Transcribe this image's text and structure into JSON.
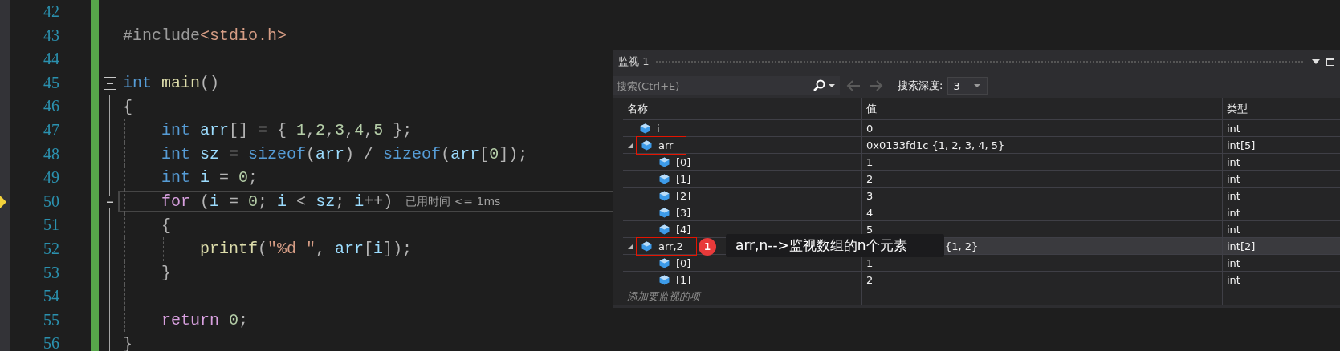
{
  "editor": {
    "lines": [
      {
        "number": "42",
        "fold": false,
        "current": false
      },
      {
        "number": "43",
        "fold": false,
        "current": false,
        "tokens": [
          {
            "t": "#include",
            "color": "#9b9b9b"
          },
          {
            "t": "<stdio.h>",
            "color": "#d69d85"
          }
        ]
      },
      {
        "number": "44",
        "fold": false,
        "current": false
      },
      {
        "number": "45",
        "fold": true,
        "current": false,
        "tokens": [
          {
            "t": "int ",
            "color": "#569cd6"
          },
          {
            "t": "main",
            "color": "#dcdcaa"
          },
          {
            "t": "()",
            "color": "#b4b4b4"
          }
        ]
      },
      {
        "number": "46",
        "fold": false,
        "current": false,
        "tokens": [
          {
            "t": "{",
            "color": "#b4b4b4"
          }
        ],
        "children": [
          {
            "number": "47",
            "fold": false,
            "current": false,
            "tokens": [
              {
                "t": "int ",
                "color": "#569cd6"
              },
              {
                "t": "arr",
                "color": "#9cdcfe"
              },
              {
                "t": "[] = { ",
                "color": "#b4b4b4"
              },
              {
                "t": "1",
                "color": "#b5cea8"
              },
              {
                "t": ",",
                "color": "#b4b4b4"
              },
              {
                "t": "2",
                "color": "#b5cea8"
              },
              {
                "t": ",",
                "color": "#b4b4b4"
              },
              {
                "t": "3",
                "color": "#b5cea8"
              },
              {
                "t": ",",
                "color": "#b4b4b4"
              },
              {
                "t": "4",
                "color": "#b5cea8"
              },
              {
                "t": ",",
                "color": "#b4b4b4"
              },
              {
                "t": "5",
                "color": "#b5cea8"
              },
              {
                "t": " };",
                "color": "#b4b4b4"
              }
            ]
          },
          {
            "number": "48",
            "fold": false,
            "current": false,
            "tokens": [
              {
                "t": "int ",
                "color": "#569cd6"
              },
              {
                "t": "sz",
                "color": "#9cdcfe"
              },
              {
                "t": " = ",
                "color": "#b4b4b4"
              },
              {
                "t": "sizeof",
                "color": "#569cd6"
              },
              {
                "t": "(",
                "color": "#b4b4b4"
              },
              {
                "t": "arr",
                "color": "#9cdcfe"
              },
              {
                "t": ") / ",
                "color": "#b4b4b4"
              },
              {
                "t": "sizeof",
                "color": "#569cd6"
              },
              {
                "t": "(",
                "color": "#b4b4b4"
              },
              {
                "t": "arr",
                "color": "#9cdcfe"
              },
              {
                "t": "[",
                "color": "#b4b4b4"
              },
              {
                "t": "0",
                "color": "#b5cea8"
              },
              {
                "t": "]);",
                "color": "#b4b4b4"
              }
            ]
          },
          {
            "number": "49",
            "fold": false,
            "current": false,
            "tokens": [
              {
                "t": "int ",
                "color": "#569cd6"
              },
              {
                "t": "i",
                "color": "#9cdcfe"
              },
              {
                "t": " = ",
                "color": "#b4b4b4"
              },
              {
                "t": "0",
                "color": "#b5cea8"
              },
              {
                "t": ";",
                "color": "#b4b4b4"
              }
            ]
          },
          {
            "number": "50",
            "fold": true,
            "current": true,
            "hint": "已用时间 <= 1ms",
            "tokens": [
              {
                "t": "for",
                "color": "#d8a0df"
              },
              {
                "t": " (",
                "color": "#b4b4b4"
              },
              {
                "t": "i",
                "color": "#9cdcfe"
              },
              {
                "t": " = ",
                "color": "#b4b4b4"
              },
              {
                "t": "0",
                "color": "#b5cea8"
              },
              {
                "t": "; ",
                "color": "#b4b4b4"
              },
              {
                "t": "i",
                "color": "#9cdcfe"
              },
              {
                "t": " < ",
                "color": "#b4b4b4"
              },
              {
                "t": "sz",
                "color": "#9cdcfe"
              },
              {
                "t": "; ",
                "color": "#b4b4b4"
              },
              {
                "t": "i",
                "color": "#9cdcfe"
              },
              {
                "t": "++)",
                "color": "#b4b4b4"
              }
            ]
          },
          {
            "number": "51",
            "fold": false,
            "current": false,
            "tokens": [
              {
                "t": "{",
                "color": "#b4b4b4"
              }
            ],
            "children": [
              {
                "number": "52",
                "fold": false,
                "current": false,
                "tokens": [
                  {
                    "t": "printf",
                    "color": "#dcdcaa"
                  },
                  {
                    "t": "(",
                    "color": "#b4b4b4"
                  },
                  {
                    "t": "\"%d \"",
                    "color": "#d69d85"
                  },
                  {
                    "t": ", ",
                    "color": "#b4b4b4"
                  },
                  {
                    "t": "arr",
                    "color": "#9cdcfe"
                  },
                  {
                    "t": "[",
                    "color": "#b4b4b4"
                  },
                  {
                    "t": "i",
                    "color": "#9cdcfe"
                  },
                  {
                    "t": "]);",
                    "color": "#b4b4b4"
                  }
                ]
              }
            ]
          },
          {
            "number": "53",
            "fold": false,
            "current": false,
            "tokens": [
              {
                "t": "}",
                "color": "#b4b4b4"
              }
            ]
          },
          {
            "number": "54",
            "fold": false,
            "current": false
          },
          {
            "number": "55",
            "fold": false,
            "current": false,
            "tokens": [
              {
                "t": "return ",
                "color": "#d8a0df"
              },
              {
                "t": "0",
                "color": "#b5cea8"
              },
              {
                "t": ";",
                "color": "#b4b4b4"
              }
            ]
          }
        ]
      },
      {
        "number": "56",
        "fold": false,
        "current": false,
        "tokens": [
          {
            "t": "}",
            "color": "#b4b4b4"
          }
        ]
      }
    ]
  },
  "watch": {
    "title": "监视 1",
    "search": {
      "placeholder": "搜索(Ctrl+E)"
    },
    "depth": {
      "label": "搜索深度:",
      "value": "3"
    },
    "columns": [
      "名称",
      "值",
      "类型"
    ],
    "rows": [
      {
        "name": "i",
        "value": "0",
        "type": "int",
        "selected": false,
        "marked": false
      },
      {
        "name": "arr",
        "value": "0x0133fd1c {1, 2, 3, 4, 5}",
        "type": "int[5]",
        "expanded": true,
        "selected": false,
        "marked": true,
        "children": [
          {
            "name": "[0]",
            "value": "1",
            "type": "int",
            "selected": false
          },
          {
            "name": "[1]",
            "value": "2",
            "type": "int",
            "selected": false
          },
          {
            "name": "[2]",
            "value": "3",
            "type": "int",
            "selected": false
          },
          {
            "name": "[3]",
            "value": "4",
            "type": "int",
            "selected": false
          },
          {
            "name": "[4]",
            "value": "5",
            "type": "int",
            "selected": false
          }
        ]
      },
      {
        "name": "arr,2",
        "value": "{1, 2}",
        "type": "int[2]",
        "expanded": true,
        "selected": true,
        "marked": true,
        "note": {
          "badge": "1",
          "text": "arr,n-->监视数组的n个元素"
        },
        "children": [
          {
            "name": "[0]",
            "value": "1",
            "type": "int",
            "selected": false
          },
          {
            "name": "[1]",
            "value": "2",
            "type": "int",
            "selected": false
          }
        ]
      }
    ],
    "add_placeholder": "添加要监视的项"
  }
}
